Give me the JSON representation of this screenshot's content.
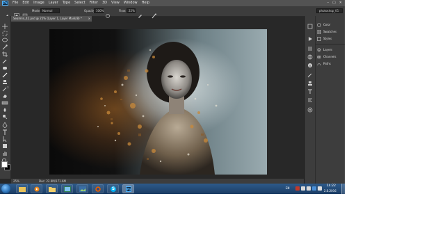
{
  "app": {
    "logo": "Ps",
    "menu": [
      "File",
      "Edit",
      "Image",
      "Layer",
      "Type",
      "Select",
      "Filter",
      "3D",
      "View",
      "Window",
      "Help"
    ],
    "window_controls": [
      "–",
      "▢",
      "✕"
    ]
  },
  "options_bar": {
    "mode_label": "Mode:",
    "mode_value": "Normal",
    "opacity_label": "Opacity:",
    "opacity_value": "100%",
    "flow_label": "Flow:",
    "flow_value": "22%",
    "workspace": "photoshop_01"
  },
  "document_tab": {
    "title": "Sealmin_42.psd @ 25% (Layer 1, Layer Mask/8) *",
    "close": "×"
  },
  "status_bar": {
    "zoom": "25%",
    "doc_size": "Doc: 22.9M/171.6M"
  },
  "panels": [
    {
      "label": "Color",
      "icon": "color-icon"
    },
    {
      "label": "Swatches",
      "icon": "swatches-icon"
    },
    {
      "label": "Styles",
      "icon": "styles-icon"
    },
    {
      "label": "Layers",
      "icon": "layers-icon"
    },
    {
      "label": "Channels",
      "icon": "channels-icon"
    },
    {
      "label": "Paths",
      "icon": "paths-icon"
    }
  ],
  "tools": [
    "move-icon",
    "marquee-icon",
    "lasso-icon",
    "quick-select-icon",
    "crop-icon",
    "eyedropper-icon",
    "healing-icon",
    "brush-icon",
    "clone-stamp-icon",
    "history-brush-icon",
    "eraser-icon",
    "gradient-icon",
    "blur-icon",
    "dodge-icon",
    "pen-icon",
    "type-icon",
    "path-select-icon",
    "shape-icon",
    "hand-icon",
    "zoom-icon"
  ],
  "taskbar": {
    "apps": [
      "explorer-icon",
      "media-player-icon",
      "folder-icon",
      "file-manager-icon",
      "photo-viewer-icon",
      "firefox-icon",
      "skype-icon",
      "photoshop-icon"
    ],
    "photoshop_label": "Ps",
    "skype_label": "S",
    "language": "EN",
    "time": "14:22",
    "date": "2.6.2016"
  },
  "colors": {
    "ps_blue": "#4fb3ff",
    "taskbar": "#1b3c63",
    "panel_bg": "#3d3d3d"
  }
}
